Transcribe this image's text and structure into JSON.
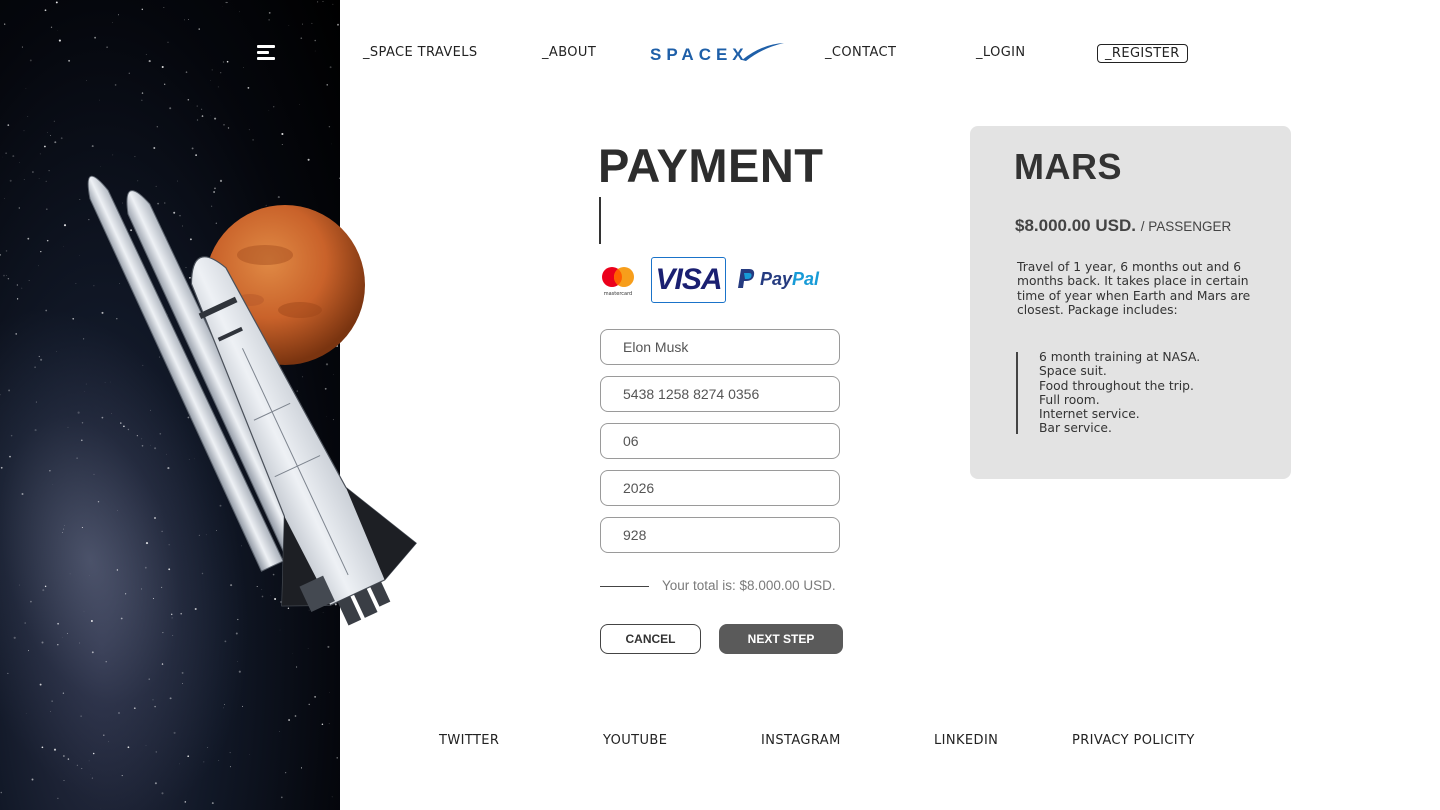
{
  "nav": {
    "space_travels": "_SPACE TRAVELS",
    "about": "_ABOUT",
    "logo": "SPACEX",
    "contact": "_CONTACT",
    "login": "_LOGIN",
    "register": "_REGISTER"
  },
  "payment": {
    "title": "PAYMENT",
    "methods": {
      "mastercard": "mastercard",
      "visa": "VISA",
      "paypal_pay": "Pay",
      "paypal_pal": "Pal"
    },
    "fields": {
      "name": "Elon Musk",
      "card_number": "5438 1258 8274 0356",
      "month": "06",
      "year": "2026",
      "cvv": "928"
    },
    "total": "Your total is: $8.000.00 USD.",
    "cancel_label": "CANCEL",
    "next_label": "NEXT STEP"
  },
  "summary": {
    "destination": "MARS",
    "price": "$8.000.00 USD.",
    "price_unit": "/ PASSENGER",
    "description_lines": [
      "Travel of 1 year, 6 months out and 6",
      "months back. It takes place in certain",
      "time of year when Earth and Mars are",
      "closest. Package includes:"
    ],
    "includes": [
      "6 month training at NASA.",
      "Space suit.",
      "Food throughout the trip.",
      "Full room.",
      "Internet service.",
      "Bar service."
    ]
  },
  "footer": {
    "twitter": "TWITTER",
    "youtube": "YOUTUBE",
    "instagram": "INSTAGRAM",
    "linkedin": "LINKEDIN",
    "privacy": "PRIVACY POLICITY"
  },
  "icons": {
    "menu": "hamburger-menu-icon",
    "mastercard": "mastercard-icon",
    "paypal": "paypal-icon"
  },
  "colors": {
    "accent_blue": "#1a73c9",
    "logo_blue": "#1e5fa8",
    "button_dark": "#5a5a5a",
    "card_bg": "#e3e3e3",
    "mars_orange": "#c9622a"
  }
}
